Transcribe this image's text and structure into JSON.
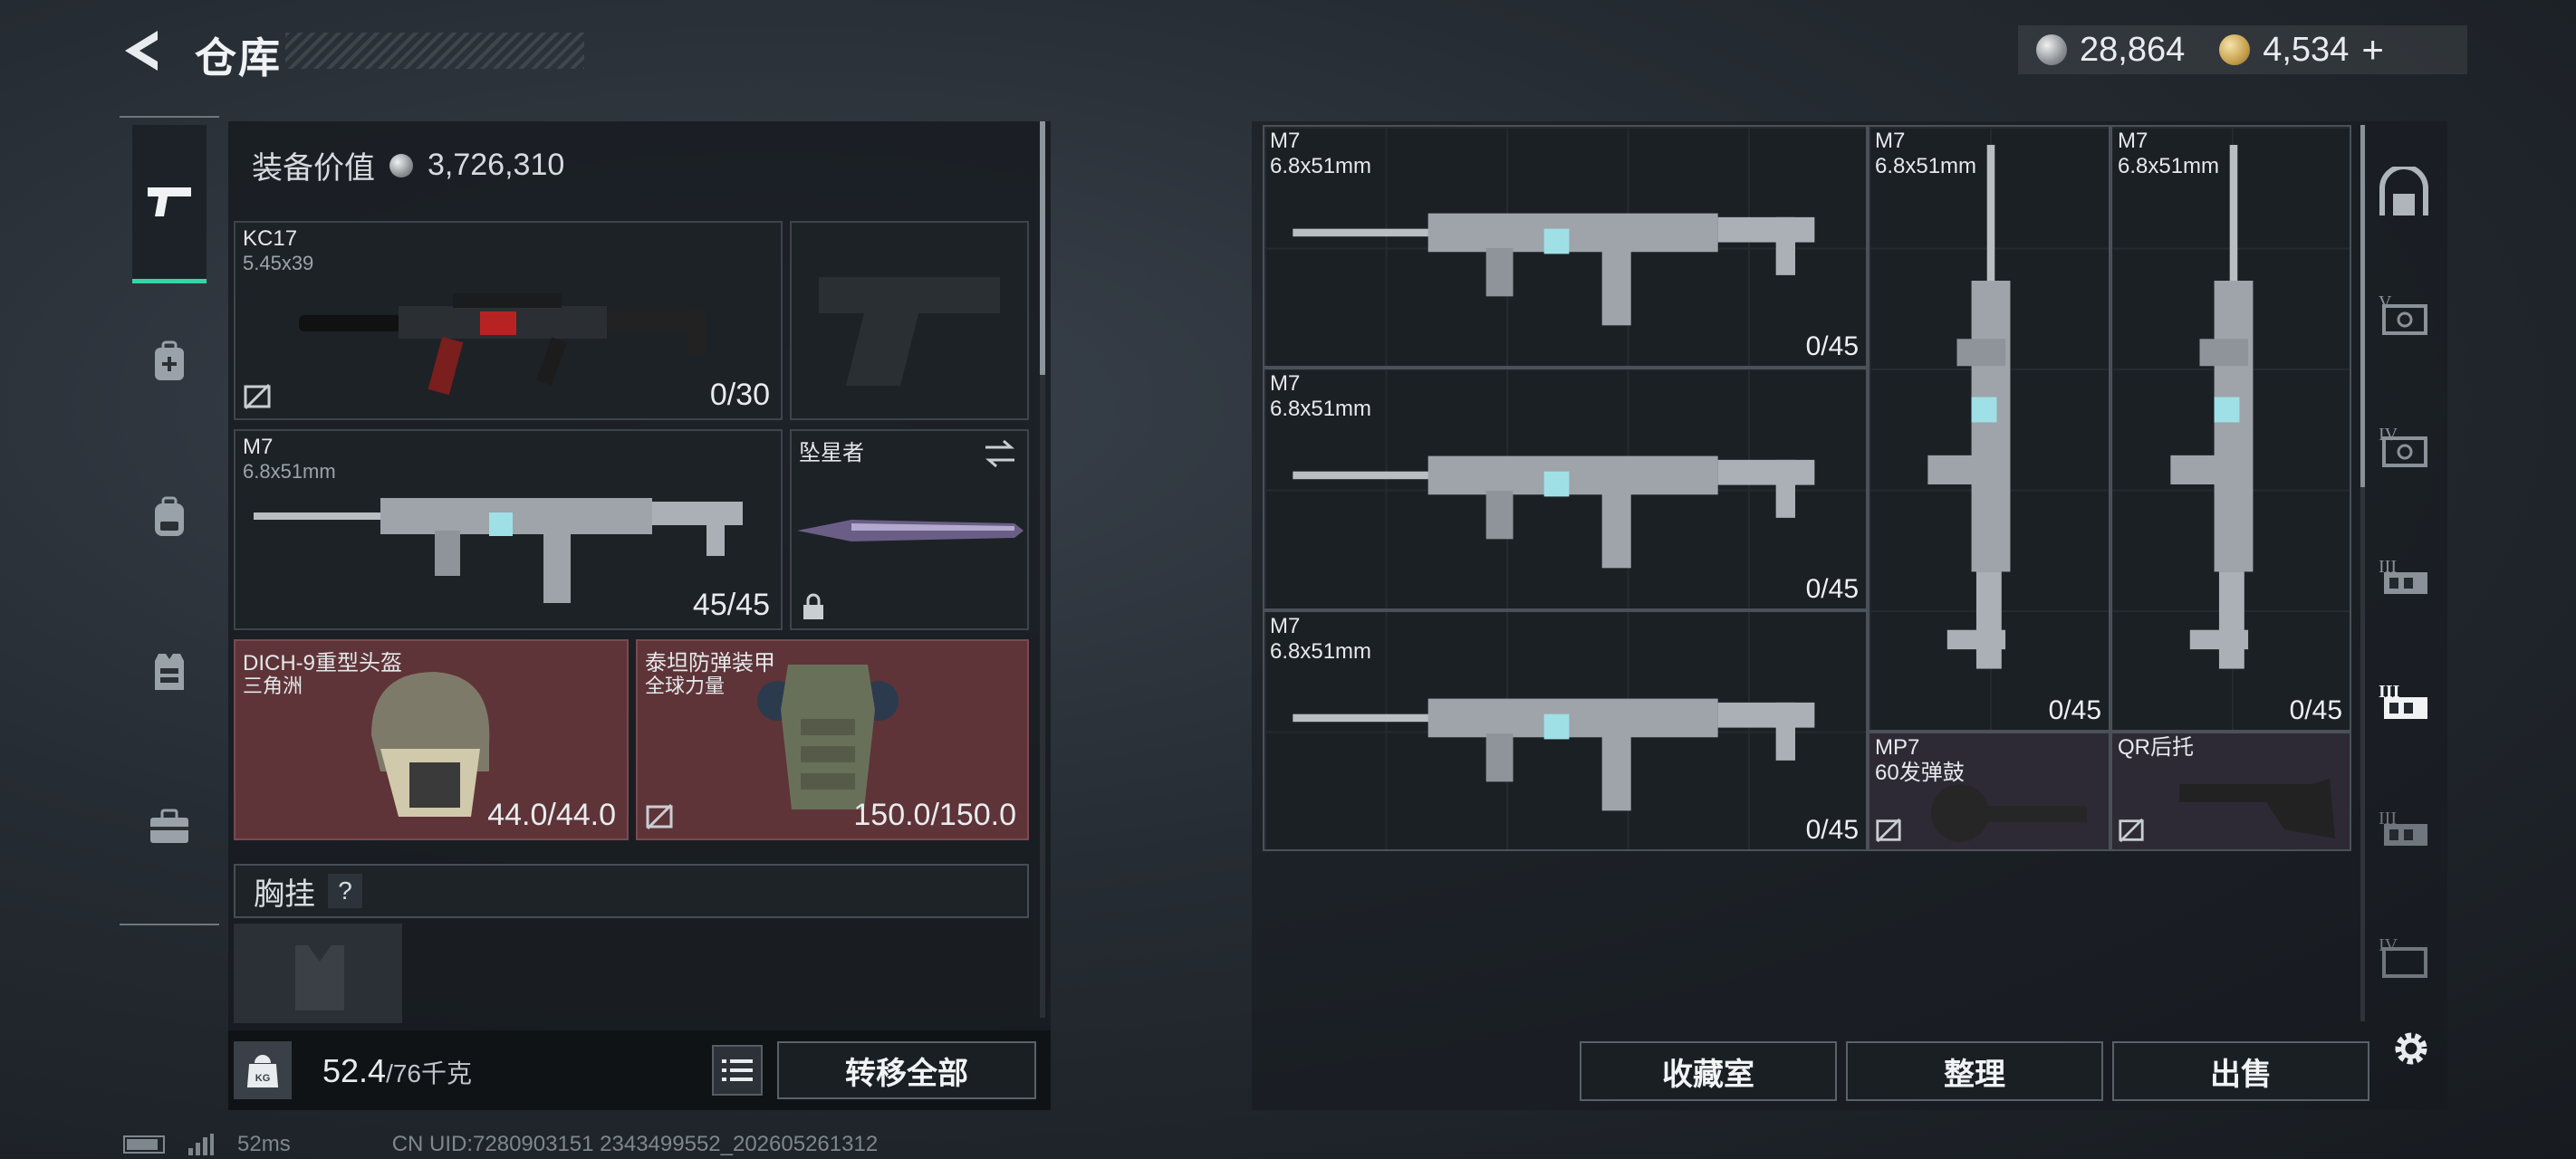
{
  "header": {
    "title": "仓库"
  },
  "currency": {
    "silver": "28,864",
    "gold": "4,534",
    "add_label": "+"
  },
  "left_nav": [
    {
      "name": "weapons",
      "icon": "pistol-icon",
      "active": true
    },
    {
      "name": "backpack-cargo",
      "icon": "backpack-plus-icon"
    },
    {
      "name": "backpack",
      "icon": "backpack-icon"
    },
    {
      "name": "vest",
      "icon": "vest-icon"
    },
    {
      "name": "case",
      "icon": "briefcase-icon"
    }
  ],
  "loadout": {
    "equip_value_label": "装备价值",
    "equip_value": "3,726,310",
    "slots": {
      "primary": {
        "name": "KC17",
        "caliber": "5.45x39",
        "count": "0/30"
      },
      "secondary": {
        "name": "M7",
        "caliber": "6.8x51mm",
        "count": "45/45"
      },
      "melee": {
        "name": "坠星者"
      },
      "helmet": {
        "name": "DICH-9重型头盔",
        "sub": "三角洲",
        "durability": "44.0/44.0"
      },
      "armor": {
        "name": "泰坦防弹装甲",
        "sub": "全球力量",
        "durability": "150.0/150.0"
      }
    },
    "chest_rig_label": "胸挂",
    "help_label": "?",
    "weight": "52.4",
    "weight_max": "/76千克",
    "weight_unit_icon": "KG",
    "transfer_all": "转移全部"
  },
  "storage": {
    "items": [
      {
        "name": "M7",
        "caliber": "6.8x51mm",
        "count": "0/45"
      },
      {
        "name": "M7",
        "caliber": "6.8x51mm",
        "count": "0/45"
      },
      {
        "name": "M7",
        "caliber": "6.8x51mm",
        "count": "0/45"
      },
      {
        "name": "M7",
        "caliber": "6.8x51mm",
        "count": "0/45"
      },
      {
        "name": "M7",
        "caliber": "6.8x51mm",
        "count": "0/45"
      },
      {
        "name": "MP7",
        "sub": "60发弹鼓"
      },
      {
        "name": "QR后托"
      }
    ],
    "buttons": {
      "collection": "收藏室",
      "organize": "整理",
      "sell": "出售"
    }
  },
  "right_nav": {
    "tiers": [
      "V",
      "IV",
      "III",
      "III",
      "III",
      "IV"
    ]
  },
  "status": {
    "ping": "52ms",
    "uid": "CN UID:7280903151 2343499552_202605261312"
  }
}
